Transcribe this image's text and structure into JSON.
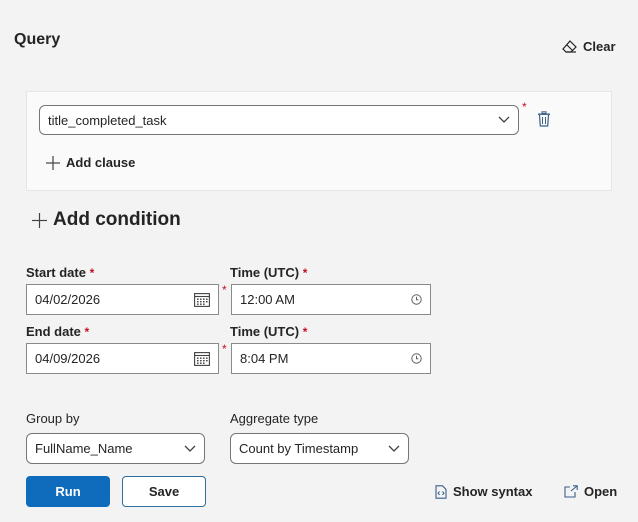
{
  "query": {
    "title": "Query",
    "clear_label": "Clear"
  },
  "clause": {
    "field_value": "title_completed_task",
    "required_mark": "*",
    "add_clause_label": "Add clause"
  },
  "condition": {
    "add_condition_label": "Add condition"
  },
  "start": {
    "date_label": "Start date",
    "date_value": "04/02/2026",
    "time_label": "Time (UTC)",
    "time_value": "12:00 AM",
    "required_mark": "*"
  },
  "end": {
    "date_label": "End date",
    "date_value": "04/09/2026",
    "time_label": "Time (UTC)",
    "time_value": "8:04 PM",
    "required_mark": "*"
  },
  "group_by": {
    "label": "Group by",
    "value": "FullName_Name"
  },
  "aggregate": {
    "label": "Aggregate type",
    "value": "Count by Timestamp"
  },
  "actions": {
    "run_label": "Run",
    "save_label": "Save",
    "show_syntax_label": "Show syntax",
    "open_label": "Open"
  },
  "colors": {
    "primary": "#0f6cbd",
    "required": "#c50f1f",
    "background": "#f3f3f3"
  }
}
